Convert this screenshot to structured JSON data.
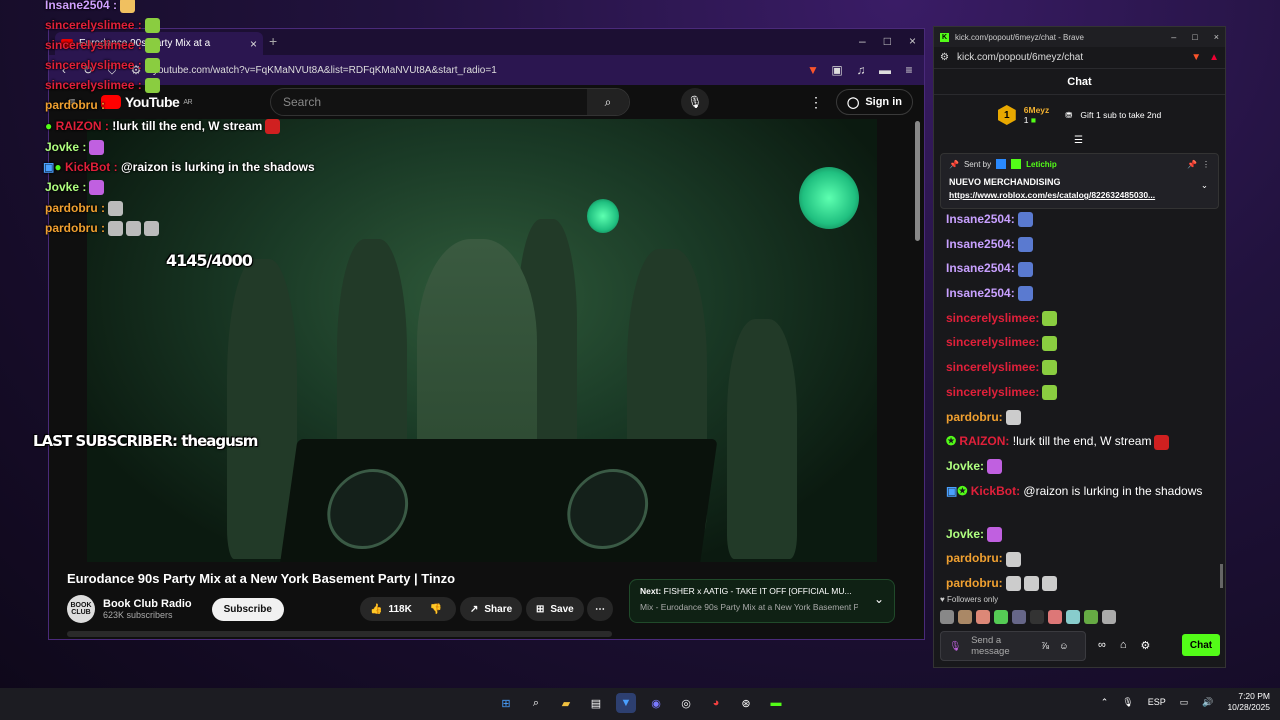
{
  "youtube": {
    "tab_title": "Eurodance 90s Party Mix at a",
    "url": "youtube.com/watch?v=FqKMaNVUt8A&list=RDFqKMaNVUt8A&start_radio=1",
    "logo": "YouTube",
    "logo_region": "AR",
    "search_placeholder": "Search",
    "sign_in": "Sign in",
    "video_title": "Eurodance 90s Party Mix at a New York Basement Party | Tinzo",
    "channel": "Book Club Radio",
    "channel_avatar": "BOOK CLUB",
    "subscribers": "623K subscribers",
    "subscribe": "Subscribe",
    "likes": "118K",
    "share": "Share",
    "save": "Save",
    "next_label": "Next:",
    "next_title": "FISHER x AATIG - TAKE IT OFF [OFFICIAL MU...",
    "next_sub": "Mix - Eurodance 90s Party Mix at a New York Basement Part..."
  },
  "overlay": {
    "goal": "4145/4000",
    "last_sub": "LAST SUBSCRIBER: theagusm",
    "lines": [
      {
        "user": "Insane2504 :",
        "color": "#d0a0ff",
        "text": ""
      },
      {
        "user": "sincerelyslimee :",
        "color": "#e0203a",
        "text": ""
      },
      {
        "user": "sincerelyslimee :",
        "color": "#e0203a",
        "text": ""
      },
      {
        "user": "sincerelyslimee :",
        "color": "#e0203a",
        "text": ""
      },
      {
        "user": "sincerelyslimee :",
        "color": "#e0203a",
        "text": ""
      },
      {
        "user": "pardobru :",
        "color": "#f0a030",
        "text": ""
      },
      {
        "user": "RAIZON :",
        "color": "#e0203a",
        "text": "!lurk till the end, W stream"
      },
      {
        "user": "Jovke :",
        "color": "#b0ff80",
        "text": ""
      },
      {
        "user": "KickBot :",
        "color": "#e0203a",
        "text": "@raizon is lurking in the shadows"
      },
      {
        "user": "Jovke :",
        "color": "#b0ff80",
        "text": ""
      },
      {
        "user": "pardobru :",
        "color": "#f0a030",
        "text": ""
      },
      {
        "user": "pardobru :",
        "color": "#f0a030",
        "text": ""
      }
    ]
  },
  "kick": {
    "window_title": "kick.com/popout/6meyz/chat - Brave",
    "url": "kick.com/popout/6meyz/chat",
    "header": "Chat",
    "top_user": "6Meyz",
    "top_rank": "1",
    "top_count": "1",
    "gift_text": "Gift 1 sub to take 2nd",
    "pin_sent_by": "Sent by",
    "pin_user": "Letichip",
    "pin_message": "NUEVO MERCHANDISING",
    "pin_link": "https://www.roblox.com/es/catalog/822632485030...",
    "messages": [
      {
        "user": "Insane2504:",
        "color": "#c8a0ff",
        "text": ""
      },
      {
        "user": "Insane2504:",
        "color": "#c8a0ff",
        "text": ""
      },
      {
        "user": "Insane2504:",
        "color": "#c8a0ff",
        "text": ""
      },
      {
        "user": "Insane2504:",
        "color": "#c8a0ff",
        "text": ""
      },
      {
        "user": "sincerelyslimee:",
        "color": "#e0203a",
        "text": ""
      },
      {
        "user": "sincerelyslimee:",
        "color": "#e0203a",
        "text": ""
      },
      {
        "user": "sincerelyslimee:",
        "color": "#e0203a",
        "text": ""
      },
      {
        "user": "sincerelyslimee:",
        "color": "#e0203a",
        "text": ""
      },
      {
        "user": "pardobru:",
        "color": "#f0a030",
        "text": ""
      },
      {
        "user": "RAIZON:",
        "color": "#e0203a",
        "text": " !lurk till the end, W stream"
      },
      {
        "user": "Jovke:",
        "color": "#b0ff80",
        "text": ""
      },
      {
        "user": "KickBot:",
        "color": "#e0203a",
        "text": " @raizon is lurking in the shadows"
      },
      {
        "user": "Jovke:",
        "color": "#b0ff80",
        "text": ""
      },
      {
        "user": "pardobru:",
        "color": "#f0a030",
        "text": ""
      },
      {
        "user": "pardobru:",
        "color": "#f0a030",
        "text": ""
      }
    ],
    "followers_only": "Followers only",
    "input_placeholder": "Send a message",
    "chat_button": "Chat"
  },
  "taskbar": {
    "lang": "ESP",
    "time": "7:20 PM",
    "date": "10/28/2025"
  }
}
